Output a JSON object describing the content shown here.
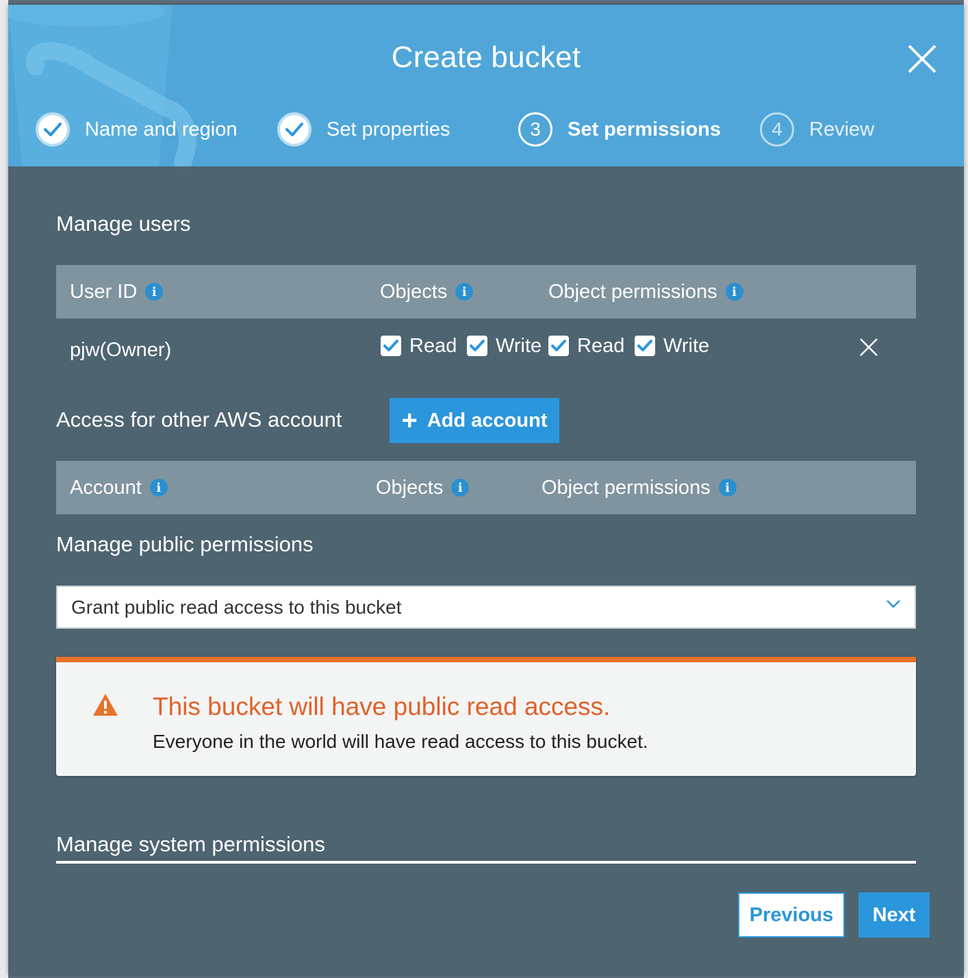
{
  "modal": {
    "title": "Create bucket"
  },
  "steps": [
    {
      "label": "Name and region",
      "state": "complete"
    },
    {
      "label": "Set properties",
      "state": "complete"
    },
    {
      "label": "Set permissions",
      "number": "3",
      "state": "current"
    },
    {
      "label": "Review",
      "number": "4",
      "state": "future"
    }
  ],
  "manage_users": {
    "title": "Manage users",
    "columns": {
      "user_id": "User ID",
      "objects": "Objects",
      "object_permissions": "Object permissions"
    },
    "rows": [
      {
        "user": "pjw(Owner)",
        "objects": [
          {
            "label": "Read",
            "checked": true
          },
          {
            "label": "Write",
            "checked": true
          }
        ],
        "object_permissions": [
          {
            "label": "Read",
            "checked": true
          },
          {
            "label": "Write",
            "checked": true
          }
        ]
      }
    ]
  },
  "other_accounts": {
    "title": "Access for other AWS account",
    "add_button": "Add account",
    "columns": {
      "account": "Account",
      "objects": "Objects",
      "object_permissions": "Object permissions"
    }
  },
  "public_permissions": {
    "title": "Manage public permissions",
    "selected": "Grant public read access to this bucket"
  },
  "warning": {
    "title": "This bucket will have public read access.",
    "text": "Everyone in the world will have read access to this bucket."
  },
  "system_permissions": {
    "title": "Manage system permissions"
  },
  "footer": {
    "previous": "Previous",
    "next": "Next"
  },
  "icons": {
    "close": "close-icon",
    "check": "checkmark-icon",
    "info": "info-icon",
    "plus": "plus-icon",
    "chevron": "chevron-down-icon",
    "warning": "warning-triangle-icon"
  },
  "colors": {
    "header": "#50a6d8",
    "body": "#4e6471",
    "table_header": "#7f949f",
    "accent": "#2b96db",
    "warning": "#e8722a"
  }
}
